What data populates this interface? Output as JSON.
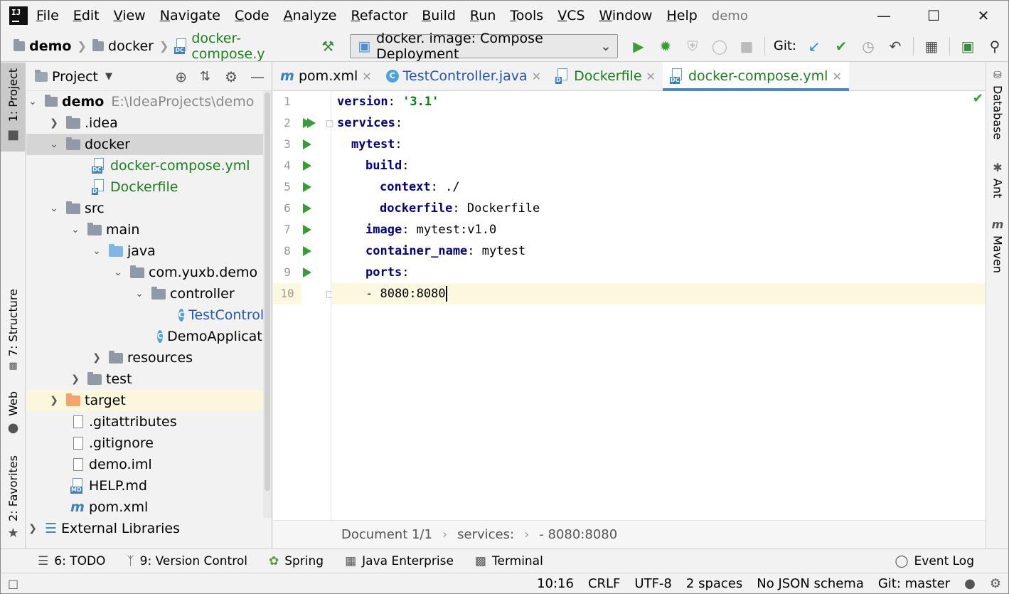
{
  "window": {
    "title": "demo",
    "menu": [
      "File",
      "Edit",
      "View",
      "Navigate",
      "Code",
      "Analyze",
      "Refactor",
      "Build",
      "Run",
      "Tools",
      "VCS",
      "Window",
      "Help"
    ]
  },
  "nav": {
    "crumbs": [
      "demo",
      "docker",
      "docker-compose.y"
    ],
    "run_config": "docker.  image: Compose Deployment",
    "git_label": "Git:"
  },
  "left_strip": [
    "1: Project",
    "7: Structure",
    "Web",
    "2: Favorites"
  ],
  "right_strip": [
    "Database",
    "Ant",
    "Maven"
  ],
  "project": {
    "header": "Project",
    "root_name": "demo",
    "root_path": "E:\\IdeaProjects\\demo",
    "items": [
      {
        "label": ".idea"
      },
      {
        "label": "docker"
      },
      {
        "label": "docker-compose.yml"
      },
      {
        "label": "Dockerfile"
      },
      {
        "label": "src"
      },
      {
        "label": "main"
      },
      {
        "label": "java"
      },
      {
        "label": "com.yuxb.demo"
      },
      {
        "label": "controller"
      },
      {
        "label": "TestController"
      },
      {
        "label": "DemoApplication"
      },
      {
        "label": "resources"
      },
      {
        "label": "test"
      },
      {
        "label": "target"
      },
      {
        "label": ".gitattributes"
      },
      {
        "label": ".gitignore"
      },
      {
        "label": "demo.iml"
      },
      {
        "label": "HELP.md"
      },
      {
        "label": "pom.xml"
      },
      {
        "label": "External Libraries"
      }
    ]
  },
  "tabs": [
    {
      "label": "pom.xml"
    },
    {
      "label": "TestController.java"
    },
    {
      "label": "Dockerfile"
    },
    {
      "label": "docker-compose.yml"
    }
  ],
  "code": {
    "line_numbers": [
      "1",
      "2",
      "3",
      "4",
      "5",
      "6",
      "7",
      "8",
      "9",
      "10"
    ],
    "lines": [
      {
        "k": "version",
        "rest": ": ",
        "str": "'3.1'"
      },
      {
        "k": "services",
        "rest": ":",
        "str": ""
      },
      {
        "k": "mytest",
        "rest": ":",
        "str": ""
      },
      {
        "k": "build",
        "rest": ":",
        "str": ""
      },
      {
        "k": "context",
        "rest": ": ./",
        "str": ""
      },
      {
        "k": "dockerfile",
        "rest": ": Dockerfile",
        "str": ""
      },
      {
        "k": "image",
        "rest": ": mytest:v1.0",
        "str": ""
      },
      {
        "k": "container_name",
        "rest": ": mytest",
        "str": ""
      },
      {
        "k": "ports",
        "rest": ":",
        "str": ""
      },
      {
        "k": "",
        "rest": "- 8080:8080",
        "str": ""
      }
    ]
  },
  "editor_breadcrumb": [
    "Document 1/1",
    "services:",
    "- 8080:8080"
  ],
  "tool_windows": [
    "6: TODO",
    "9: Version Control",
    "Spring",
    "Java Enterprise",
    "Terminal"
  ],
  "event_log": "Event Log",
  "status": {
    "position": "10:16",
    "line_sep": "CRLF",
    "encoding": "UTF-8",
    "indent": "2 spaces",
    "schema": "No JSON schema",
    "git": "Git: master"
  }
}
